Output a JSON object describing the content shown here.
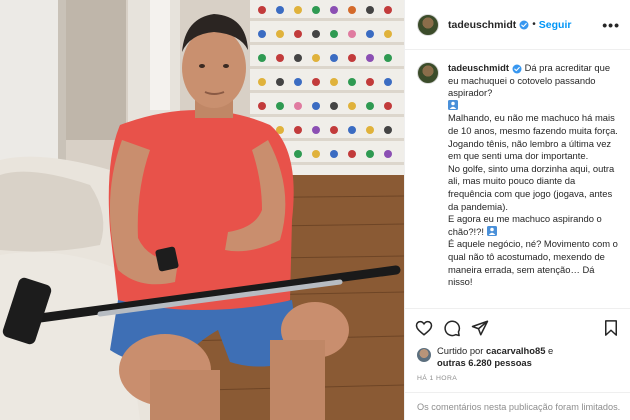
{
  "post": {
    "username": "tadeuschmidt",
    "follow_label": "Seguir",
    "more_label": "•••",
    "caption_lines": [
      "Dá pra acreditar que eu machuquei o cotovelo passando aspirador?",
      "Malhando, eu não me machuco há mais de 10 anos, mesmo fazendo muita força.",
      "Jogando tênis, não lembro a última vez em que senti uma dor importante.",
      "No golfe, sinto uma dorzinha aqui, outra ali, mas muito pouco diante da frequência com que jogo (jogava, antes da pandemia).",
      "E agora eu me machuco aspirando o chão?!?!",
      "É aquele negócio, né? Movimento com o qual não tô acostumado, mexendo de maneira errada, sem atenção… Dá nisso!"
    ],
    "liked_by_prefix": "Curtido por",
    "liked_by_user": "cacarvalho85",
    "liked_by_mid": "e",
    "liked_by_others": "outras 6.280 pessoas",
    "timestamp": "HÁ 1 HORA",
    "comments_limited": "Os comentários nesta publicação foram limitados."
  },
  "icons": {
    "like": "heart-icon",
    "comment": "comment-icon",
    "share": "share-icon",
    "save": "bookmark-icon",
    "verified": "verified-badge-icon",
    "emoji": "person-emoji-icon"
  },
  "colors": {
    "accent": "#0095f6",
    "text": "#262626",
    "muted": "#8e8e8e",
    "border": "#efefef"
  }
}
